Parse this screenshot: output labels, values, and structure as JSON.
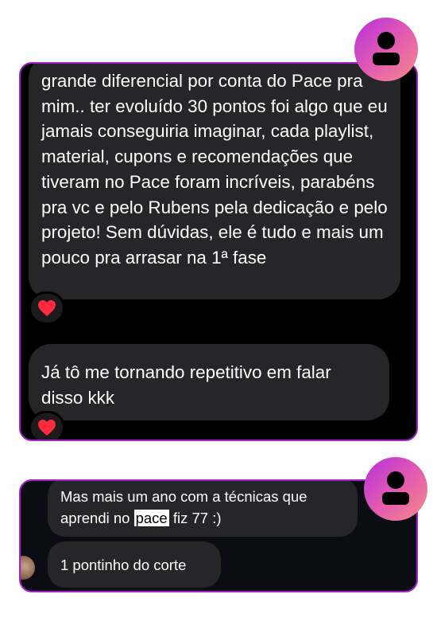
{
  "conversation1": {
    "message1": "grande diferencial por conta do Pace pra mim.. ter evoluído 30 pontos foi algo que eu jamais conseguiria imaginar, cada playlist, material, cupons e recomendações que tiveram no Pace foram incríveis, parabéns pra vc e pelo Rubens pela dedicação e pelo projeto! Sem dúvidas, ele é tudo e mais um pouco pra arrasar na 1ª fase",
    "message2": "Já tô me tornando repetitivo em falar disso kkk",
    "reaction": "❤"
  },
  "conversation2": {
    "message1_before": "Mas mais um ano com a técnicas que aprendi no ",
    "message1_highlight": "pace",
    "message1_after": " fiz 77 :)",
    "message2": "1 pontinho do corte"
  },
  "colors": {
    "border": "#a321c9",
    "bubble": "#262629",
    "heart": "#ff2a3d",
    "avatar_gradient": [
      "#b62fde",
      "#e45eae",
      "#f48c8a"
    ]
  },
  "icons": [
    "user-avatar-icon",
    "heart-icon"
  ]
}
